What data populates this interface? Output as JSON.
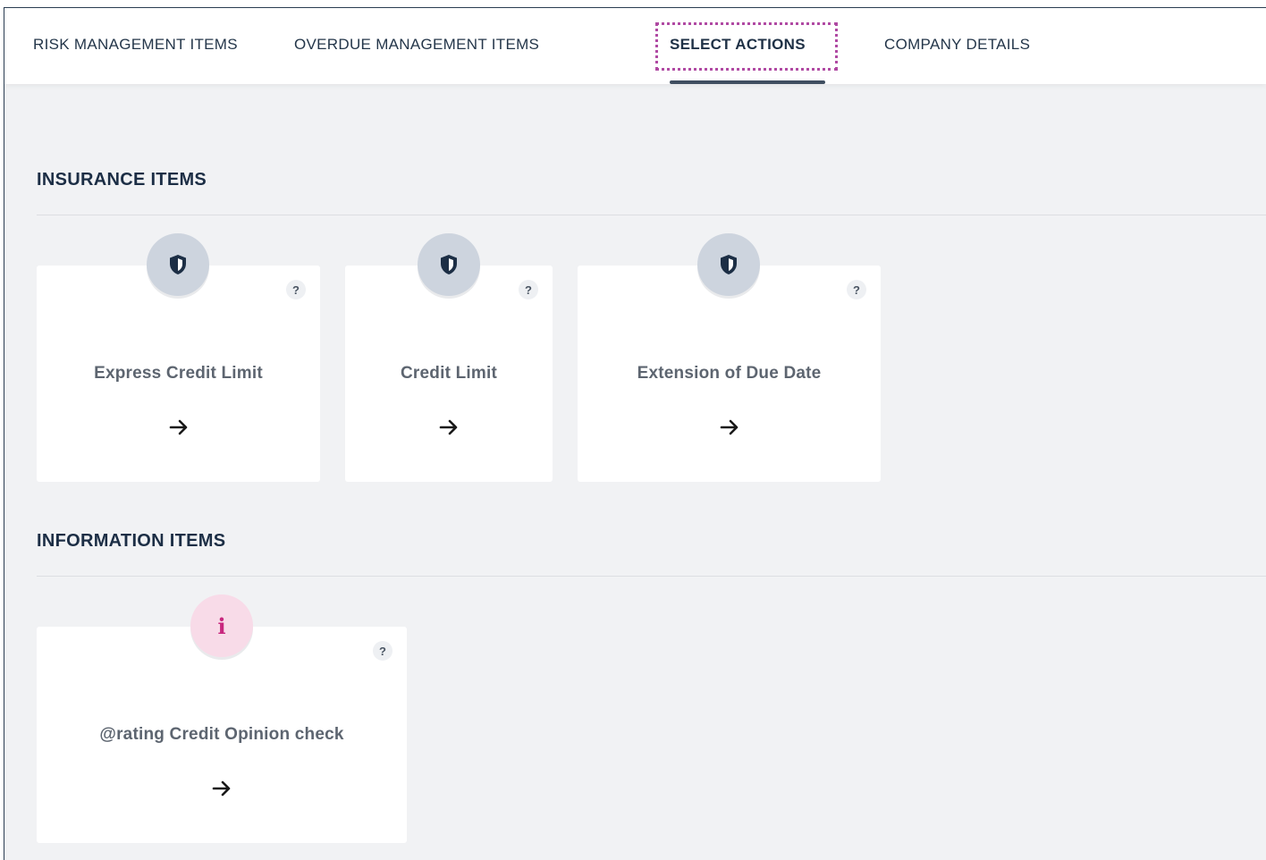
{
  "nav": {
    "tabs": [
      {
        "label": "RISK MANAGEMENT ITEMS"
      },
      {
        "label": "OVERDUE MANAGEMENT ITEMS"
      },
      {
        "label": "SELECT ACTIONS",
        "active": true
      },
      {
        "label": "COMPANY DETAILS"
      }
    ]
  },
  "insurance": {
    "title": "INSURANCE ITEMS",
    "items": [
      {
        "label": "Express Credit Limit",
        "icon": "shield-icon",
        "help": "?"
      },
      {
        "label": "Credit Limit",
        "icon": "shield-icon",
        "help": "?"
      },
      {
        "label": "Extension of Due Date",
        "icon": "shield-icon",
        "help": "?"
      }
    ]
  },
  "information": {
    "title": "INFORMATION ITEMS",
    "items": [
      {
        "label": "@rating Credit Opinion check",
        "icon": "info-icon",
        "glyph": "i",
        "help": "?"
      }
    ]
  },
  "colors": {
    "navy": "#1c2e45",
    "focus_ring": "#b04aa3",
    "shield_badge": "#cdd4de",
    "info_badge": "#f8dbe8",
    "info_glyph": "#c8277e",
    "background": "#f1f2f4"
  }
}
